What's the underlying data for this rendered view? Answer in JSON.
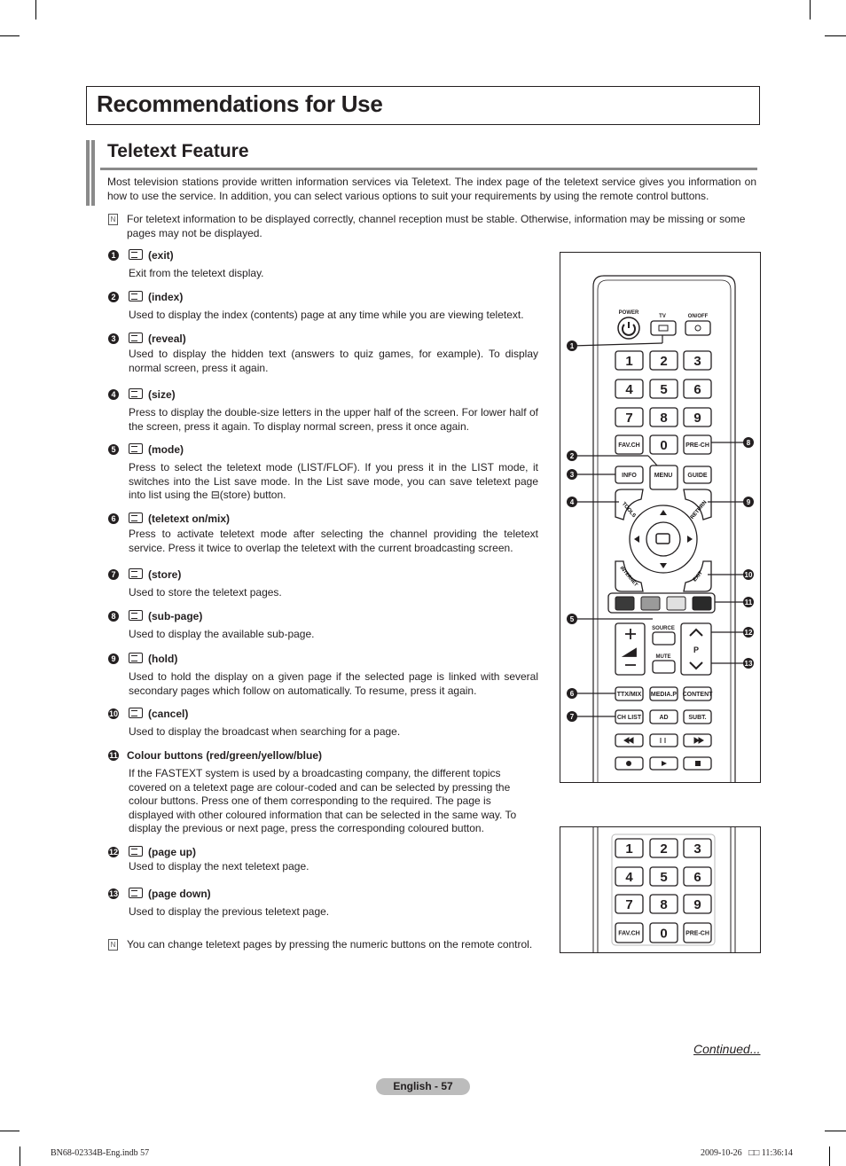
{
  "header": {
    "title": "Recommendations for Use"
  },
  "section": {
    "title": "Teletext Feature",
    "intro": "Most television stations provide written information services via Teletext. The index page of the teletext service gives you information on how to use the service. In addition, you can select various options to suit your requirements by using the remote control buttons.",
    "note1": "For teletext information to be displayed correctly, channel reception must be stable. Otherwise, information may be missing or some pages may not be displayed.",
    "note2": "You can change teletext pages by pressing the numeric buttons on the remote control."
  },
  "items": [
    {
      "num": "1",
      "title": "(exit)",
      "desc": "Exit from the teletext display."
    },
    {
      "num": "2",
      "title": "(index)",
      "desc": "Used to display the index (contents) page at any time while you are viewing teletext."
    },
    {
      "num": "3",
      "title": "(reveal)",
      "desc": "Used to display the hidden text (answers to quiz games, for example). To display normal screen, press it again."
    },
    {
      "num": "4",
      "title": "(size)",
      "desc": "Press to display the double-size letters in the upper half of the screen. For lower half of the screen, press it again. To display normal screen, press it once again."
    },
    {
      "num": "5",
      "title": "(mode)",
      "desc": "Press to select the teletext mode (LIST/FLOF). If you press it in the LIST mode, it switches into the List save mode. In the List save mode, you can save teletext page into list using the ⊟(store) button."
    },
    {
      "num": "6",
      "title": "(teletext on/mix)",
      "desc": "Press to activate teletext mode after selecting the channel providing the teletext service. Press it twice to overlap the teletext with the current broadcasting screen."
    },
    {
      "num": "7",
      "title": "(store)",
      "desc": "Used to store the teletext pages."
    },
    {
      "num": "8",
      "title": "(sub-page)",
      "desc": "Used to display the available sub-page."
    },
    {
      "num": "9",
      "title": "(hold)",
      "desc": "Used to hold the display on a given page if the selected page is linked with several secondary pages which follow on automatically. To resume, press it again."
    },
    {
      "num": "10",
      "title": "(cancel)",
      "desc": "Used to display the broadcast when searching for a page."
    },
    {
      "num": "11",
      "title": "Colour buttons (red/green/yellow/blue)",
      "desc": "If the FASTEXT system is used by a broadcasting company, the different topics covered on a teletext page are colour-coded and can be selected by pressing the colour buttons. Press one of them corresponding to the required. The page is displayed with other coloured information that can be selected in the same way. To display the previous or next page, press the corresponding coloured button."
    },
    {
      "num": "12",
      "title": "(page up)",
      "desc": "Used to display the next teletext page."
    },
    {
      "num": "13",
      "title": "(page down)",
      "desc": "Used to display the previous teletext page."
    }
  ],
  "remote": {
    "power": "POWER",
    "tv": "TV",
    "onoff": "ON/OFF",
    "digits": [
      "1",
      "2",
      "3",
      "4",
      "5",
      "6",
      "7",
      "8",
      "9"
    ],
    "zero": "0",
    "favch": "FAV.CH",
    "prech": "PRE-CH",
    "info": "INFO",
    "menu": "MENU",
    "guide": "GUIDE",
    "tools": "TOOLS",
    "return": "RETURN",
    "internet": "INTERNET",
    "exit": "EXIT",
    "source": "SOURCE",
    "mute": "MUTE",
    "p": "P",
    "ttxmix": "TTX/MIX",
    "mediap": "MEDIA.P",
    "content": "CONTENT",
    "chlist": "CH LIST",
    "ad": "AD",
    "subt": "SUBT.",
    "colour_buttons": [
      "#3a3a3a",
      "#9a9a9a",
      "#e0e0e0",
      "#2a2a2a"
    ]
  },
  "footer": {
    "continued": "Continued...",
    "page": "English - 57",
    "file": "BN68-02334B-Eng.indb   57",
    "timestamp": "2009-10-26   □□ 11:36:14"
  }
}
